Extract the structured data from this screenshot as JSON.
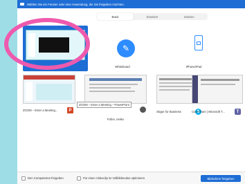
{
  "window": {
    "title": "Wählen Sie ein Fenster oder eine Anwendung, die Sie freigeben möchten."
  },
  "tabs": [
    {
      "label": "Basic"
    },
    {
      "label": "Erweitert"
    },
    {
      "label": "Dateien"
    }
  ],
  "tiles": {
    "desktop": {
      "label": "Bildschirm"
    },
    "whiteboard": {
      "label": "Whiteboard"
    },
    "iphone": {
      "label": "iPhone/iPad"
    },
    "zoom_meeting": {
      "label": "ZOOM – Enter a Meeting..."
    },
    "fuehre": {
      "label": "Führe, Heike"
    },
    "skype": {
      "label": "Skype for Business"
    },
    "teams": {
      "label": "Core-Team | Microsoft T..."
    }
  },
  "tooltip": "ZOOM – Enter a Meeting – PowerPoint",
  "bottom": {
    "share_computer_sound": "Den Computerton freigeben",
    "optimize_video": "Für einen Videoclip im Vollbildmodus optimieren",
    "share_button": "Bildschirm freigeben"
  },
  "colors": {
    "accent": "#1e6dd5",
    "annotation": "#ee5aae",
    "background": "#9fdde6"
  }
}
